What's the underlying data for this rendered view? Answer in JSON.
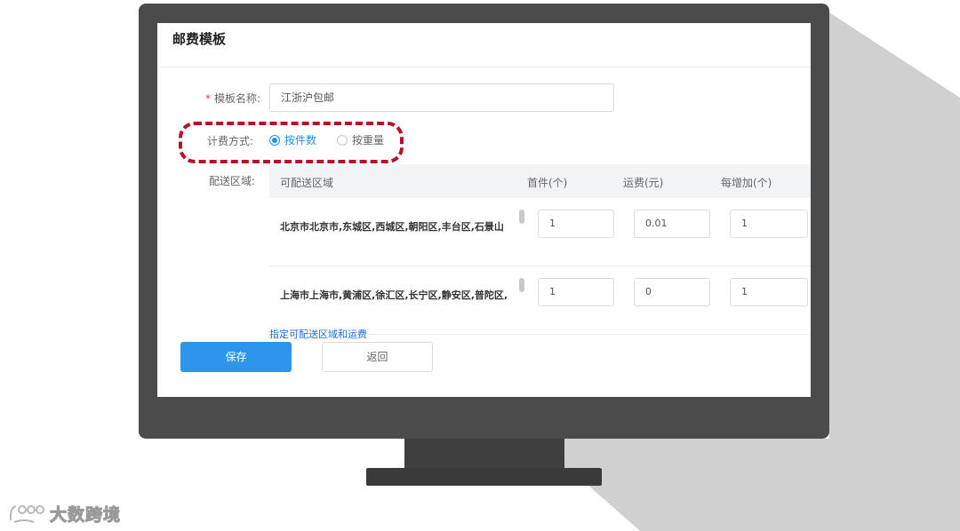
{
  "page": {
    "title": "邮费模板"
  },
  "form": {
    "template_name_label": "模板名称:",
    "template_name_required": "*",
    "template_name_value": "江浙沪包邮",
    "billing_method_label": "计费方式:",
    "billing_options": [
      {
        "label": "按件数",
        "selected": true
      },
      {
        "label": "按重量",
        "selected": false
      }
    ],
    "delivery_area_label": "配送区域:"
  },
  "table": {
    "headers": [
      "可配送区域",
      "首件(个)",
      "运费(元)",
      "每增加(个)"
    ],
    "rows": [
      {
        "region": "北京市北京市,东城区,西城区,朝阳区,丰台区,石景山",
        "first": "1",
        "fee": "0.01",
        "add": "1"
      },
      {
        "region": "上海市上海市,黄浦区,徐汇区,长宁区,静安区,普陀区,",
        "first": "1",
        "fee": "0",
        "add": "1"
      }
    ]
  },
  "actions": {
    "add_area_link": "指定可配送区域和运费",
    "save_label": "保存",
    "back_label": "返回"
  },
  "watermark": {
    "text": "大数跨境"
  },
  "colors": {
    "accent": "#2d96ec",
    "highlight": "#b5122a",
    "monitor": "#4b4b4b"
  }
}
